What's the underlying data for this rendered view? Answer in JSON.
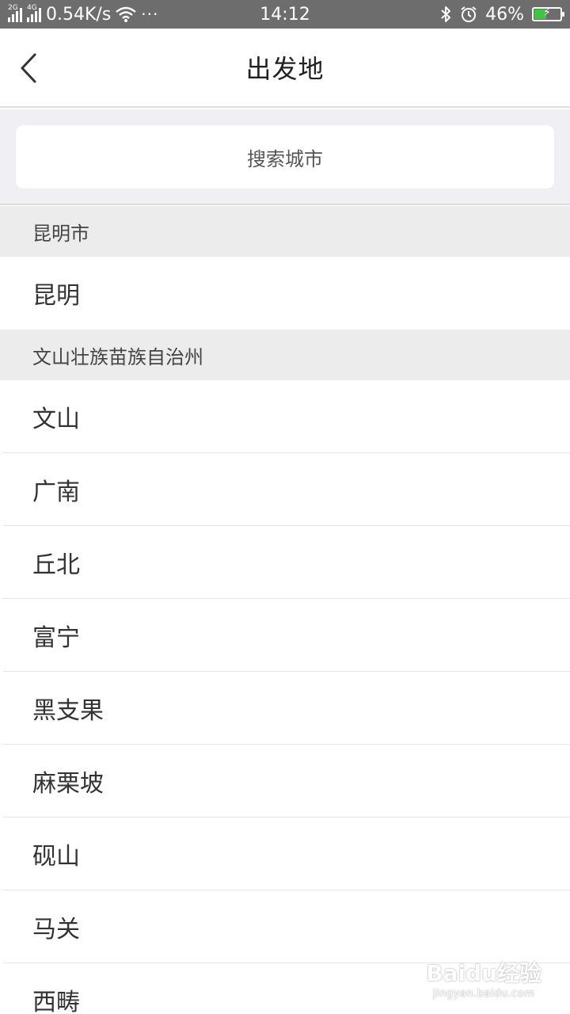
{
  "status_bar": {
    "net1": "2G",
    "net2": "4G",
    "speed": "0.54K/s",
    "more": "···",
    "time": "14:12",
    "battery_percent_text": "46%",
    "battery_level": 0.46,
    "icons": [
      "signal-icon",
      "wifi-icon",
      "bluetooth-icon",
      "alarm-icon",
      "battery-charging-icon"
    ]
  },
  "nav": {
    "title": "出发地",
    "back_icon": "chevron-left-icon"
  },
  "search": {
    "placeholder": "搜索城市"
  },
  "sections": [
    {
      "header": "昆明市",
      "cities": [
        "昆明"
      ]
    },
    {
      "header": "文山壮族苗族自治州",
      "cities": [
        "文山",
        "广南",
        "丘北",
        "富宁",
        "黑支果",
        "麻栗坡",
        "砚山",
        "马关",
        "西畴"
      ]
    }
  ],
  "watermark": {
    "logo": "Baidu经验",
    "url": "jingyan.baidu.com"
  },
  "colors": {
    "status_bar_bg": "#6d6d6d",
    "search_bg": "#efeff4",
    "section_header_bg": "#ececec",
    "battery_fill": "#3ec73e"
  }
}
